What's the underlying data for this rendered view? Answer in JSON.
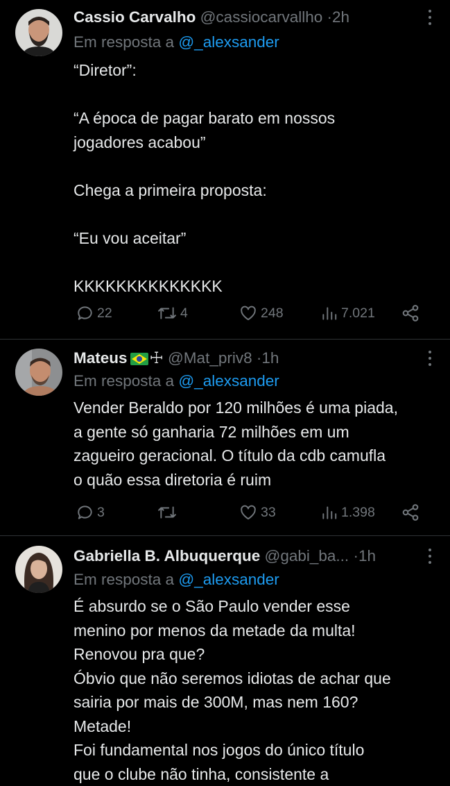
{
  "tweets": [
    {
      "name": "Cassio Carvalho",
      "handle": "@cassiocarvallho",
      "time": "2h",
      "reply_prefix": "Em resposta a",
      "reply_handle": "@_alexsander",
      "lines": [
        "“Diretor”:",
        "",
        "“A época de pagar barato em nossos",
        "jogadores acabou”",
        "",
        "Chega a primeira proposta:",
        "",
        "“Eu vou aceitar”",
        "",
        "KKKKKKKKKKKKKK"
      ],
      "replies": "22",
      "retweets": "4",
      "likes": "248",
      "views": "7.021"
    },
    {
      "name": "Mateus",
      "name_suffix": "☩",
      "handle": "@Mat_priv8",
      "time": "1h",
      "reply_prefix": "Em resposta a",
      "reply_handle": "@_alexsander",
      "lines": [
        "Vender Beraldo por 120 milhões é uma piada,",
        "a gente só ganharia 72 milhões em um",
        "zagueiro geracional. O título da cdb camufla",
        "o quão essa diretoria é ruim"
      ],
      "replies": "3",
      "retweets": "",
      "likes": "33",
      "views": "1.398"
    },
    {
      "name": "Gabriella B. Albuquerque",
      "handle": "@gabi_ba...",
      "time": "1h",
      "reply_prefix": "Em resposta a",
      "reply_handle": "@_alexsander",
      "lines": [
        "É absurdo se o São Paulo vender esse",
        "menino por menos da metade da multa!",
        "Renovou pra que?",
        "Óbvio que não seremos idiotas de achar que",
        "sairia por mais de 300M, mas nem 160?",
        "Metade!",
        "Foi fundamental nos jogos do único título",
        "que o clube não tinha, consistente a"
      ]
    }
  ],
  "colors": {
    "background": "#000000",
    "text": "#e7e9ea",
    "muted": "#71767b",
    "link": "#1d9bf0",
    "divider": "#2f3336"
  },
  "icons": [
    "reply-icon",
    "retweet-icon",
    "like-icon",
    "views-icon",
    "share-icon",
    "more-icon",
    "brazil-flag-icon"
  ]
}
